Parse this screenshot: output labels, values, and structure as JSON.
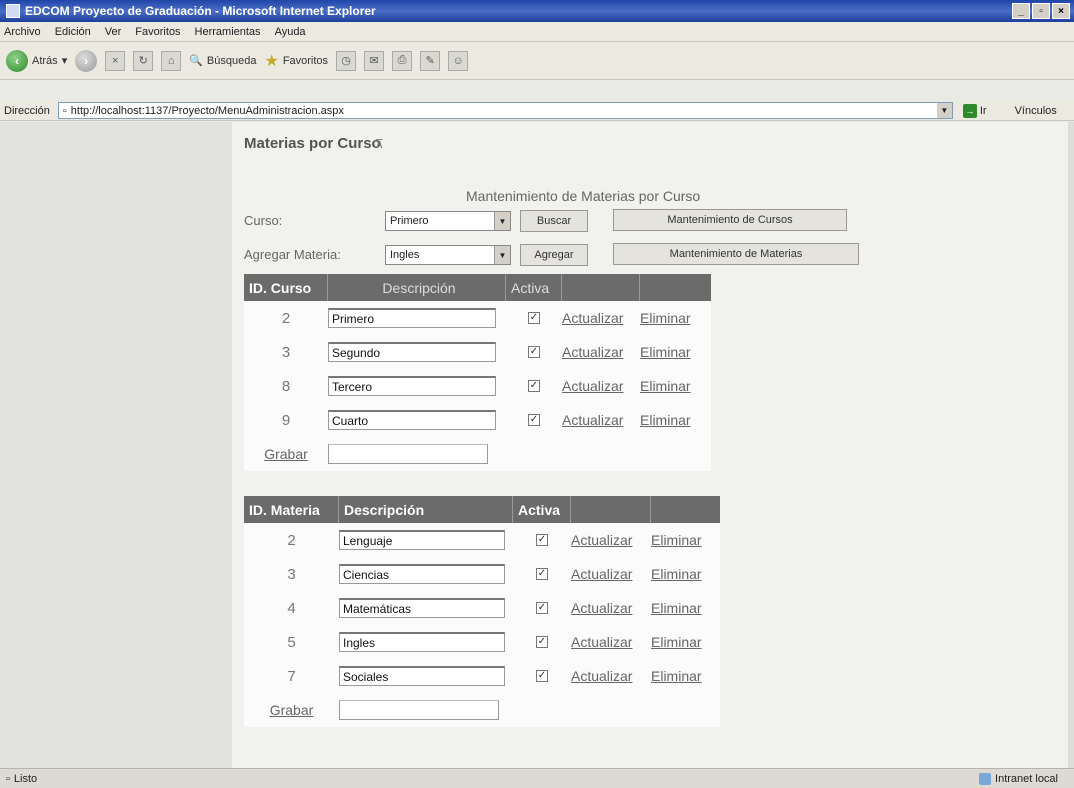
{
  "window": {
    "title": "EDCOM Proyecto de Graduación - Microsoft Internet Explorer"
  },
  "menubar": {
    "items": [
      "Archivo",
      "Edición",
      "Ver",
      "Favoritos",
      "Herramientas",
      "Ayuda"
    ]
  },
  "toolbar": {
    "back_label": "Atrás",
    "search_label": "Búsqueda",
    "favorites_label": "Favoritos"
  },
  "addressbar": {
    "label": "Dirección",
    "url": "http://localhost:1137/Proyecto/MenuAdministracion.aspx",
    "go_label": "Ir",
    "links_label": "Vínculos"
  },
  "page": {
    "heading": "Materias por Curso",
    "collapse_glyph": "⊼",
    "maint_title": "Mantenimiento de Materias por Curso",
    "curso_label": "Curso:",
    "curso_value": "Primero",
    "buscar_label": "Buscar",
    "mant_cursos_label": "Mantenimiento de Cursos",
    "agregar_label": "Agregar Materia:",
    "materia_value": "Ingles",
    "agregar_btn_label": "Agregar",
    "mant_materias_label": "Mantenimiento de Materias"
  },
  "cursos_table": {
    "headers": [
      "ID. Curso",
      "Descripción",
      "Activa",
      "",
      ""
    ],
    "rows": [
      {
        "id": "2",
        "desc": "Primero",
        "update": "Actualizar",
        "delete": "Eliminar"
      },
      {
        "id": "3",
        "desc": "Segundo",
        "update": "Actualizar",
        "delete": "Eliminar"
      },
      {
        "id": "8",
        "desc": "Tercero",
        "update": "Actualizar",
        "delete": "Eliminar"
      },
      {
        "id": "9",
        "desc": "Cuarto",
        "update": "Actualizar",
        "delete": "Eliminar"
      }
    ],
    "save_label": "Grabar",
    "new_value": ""
  },
  "materias_table": {
    "headers": [
      "ID. Materia",
      "Descripción",
      "Activa",
      "",
      ""
    ],
    "rows": [
      {
        "id": "2",
        "desc": "Lenguaje",
        "update": "Actualizar",
        "delete": "Eliminar"
      },
      {
        "id": "3",
        "desc": "Ciencias",
        "update": "Actualizar",
        "delete": "Eliminar"
      },
      {
        "id": "4",
        "desc": "Matemáticas",
        "update": "Actualizar",
        "delete": "Eliminar"
      },
      {
        "id": "5",
        "desc": "Ingles",
        "update": "Actualizar",
        "delete": "Eliminar"
      },
      {
        "id": "7",
        "desc": "Sociales",
        "update": "Actualizar",
        "delete": "Eliminar"
      }
    ],
    "save_label": "Grabar",
    "new_value": ""
  },
  "statusbar": {
    "status": "Listo",
    "zone": "Intranet local"
  }
}
